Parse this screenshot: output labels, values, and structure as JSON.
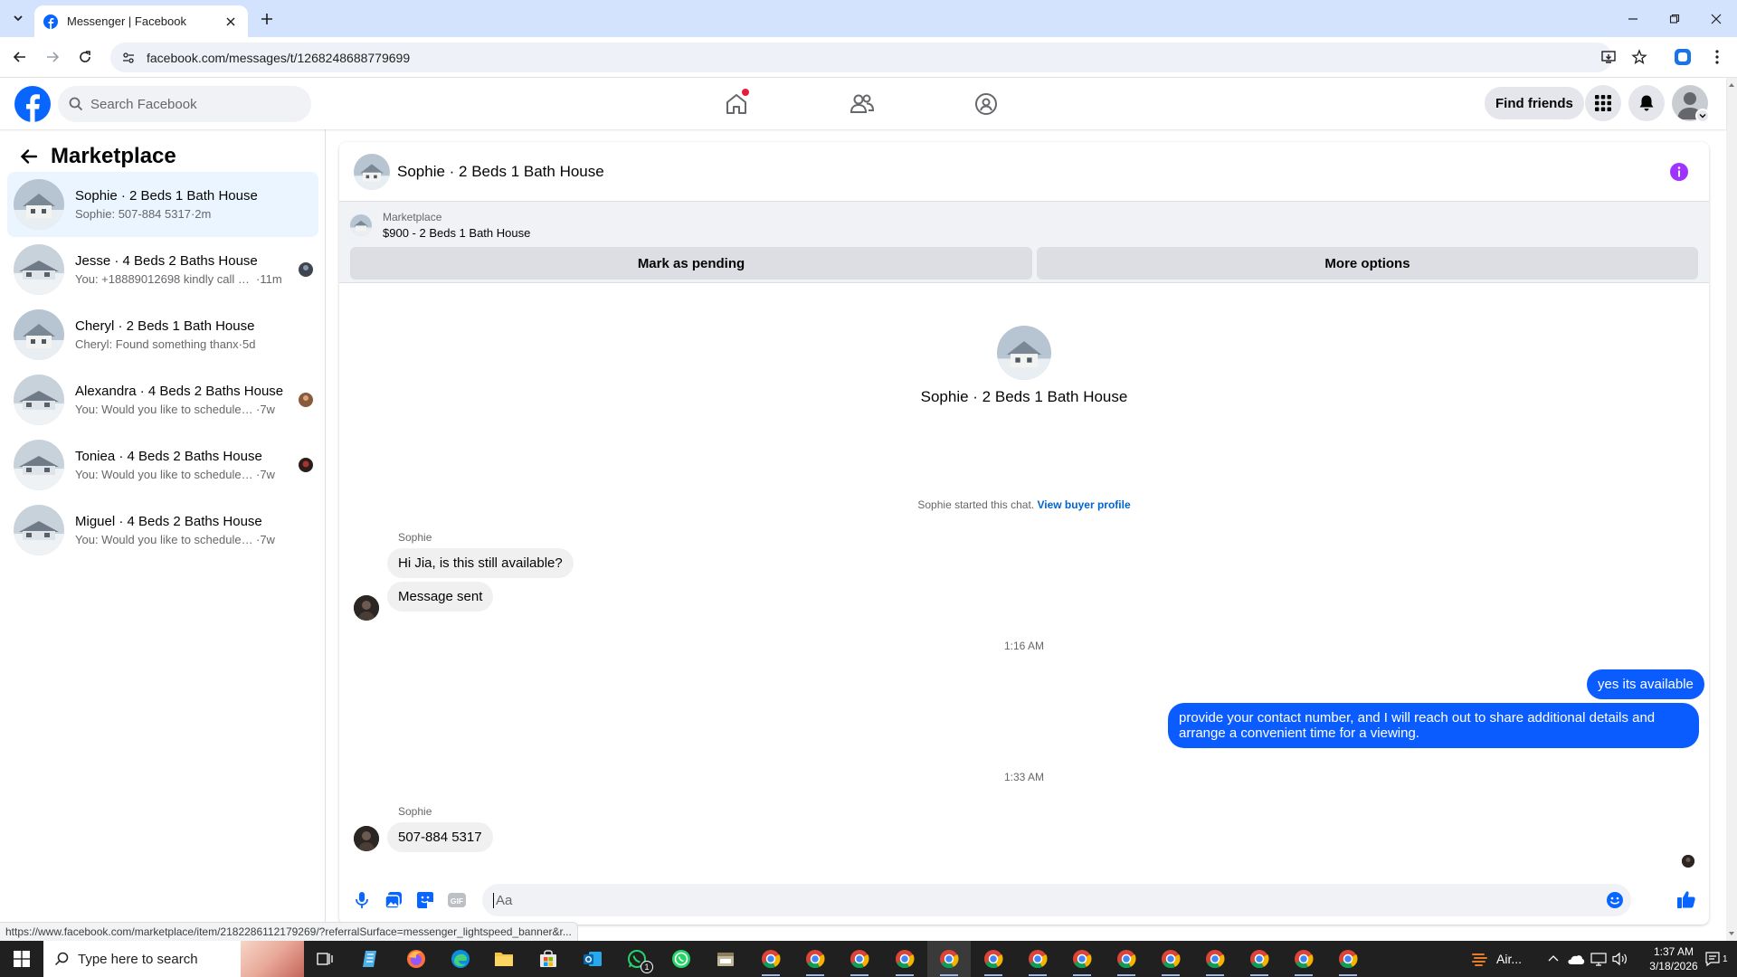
{
  "browser": {
    "tab_title": "Messenger | Facebook",
    "url": "facebook.com/messages/t/1268248688779699",
    "status_url": "https://www.facebook.com/marketplace/item/2182286112179269/?referralSurface=messenger_lightspeed_banner&r..."
  },
  "header": {
    "search_placeholder": "Search Facebook",
    "find_friends": "Find friends"
  },
  "sidebar": {
    "title": "Marketplace",
    "conversations": [
      {
        "name": "Sophie · 2 Beds 1 Bath House",
        "snippet": "Sophie: 507-884 5317",
        "time": "·2m"
      },
      {
        "name": "Jesse · 4 Beds 2 Baths House",
        "snippet": "You: +18889012698 kindly call m...",
        "time": "·11m"
      },
      {
        "name": "Cheryl · 2 Beds 1 Bath House",
        "snippet": "Cheryl: Found something thanx",
        "time": "·5d"
      },
      {
        "name": "Alexandra · 4 Beds 2 Baths House",
        "snippet": "You: Would you like to schedule a ...",
        "time": "·7w"
      },
      {
        "name": "Toniea · 4 Beds 2 Baths House",
        "snippet": "You: Would you like to schedule a ...",
        "time": "·7w"
      },
      {
        "name": "Miguel · 4 Beds 2 Baths House",
        "snippet": "You: Would you like to schedule a vie...",
        "time": "·7w"
      }
    ]
  },
  "chat": {
    "title": "Sophie · 2 Beds 1 Bath House",
    "listing_label": "Marketplace",
    "listing_price": "$900 - 2 Beds 1 Bath House",
    "mark_pending": "Mark as pending",
    "more_options": "More options",
    "intro_name": "Sophie · 2 Beds 1 Bath House",
    "started_text": "Sophie started this chat.",
    "view_profile": "View buyer profile",
    "messages": {
      "sender1": "Sophie",
      "m1": "Hi Jia, is this still available?",
      "m2": "Message sent",
      "time1": "1:16 AM",
      "m3": "yes its available",
      "m4_line1": "provide your contact number, and I will reach out to share additional details and",
      "m4_line2": "arrange a convenient time for a viewing.",
      "time2": "1:33 AM",
      "sender2": "Sophie",
      "m5": "507-884 5317"
    },
    "composer_placeholder": "Aa"
  },
  "taskbar": {
    "search_placeholder": "Type here to search",
    "weather": "Air...",
    "time": "1:37 AM",
    "date": "3/18/2026",
    "notif_count": "1"
  },
  "colors": {
    "fb_blue": "#0866ff",
    "outgoing_bubble": "#0a5cff",
    "info_purple": "#a033ff"
  }
}
